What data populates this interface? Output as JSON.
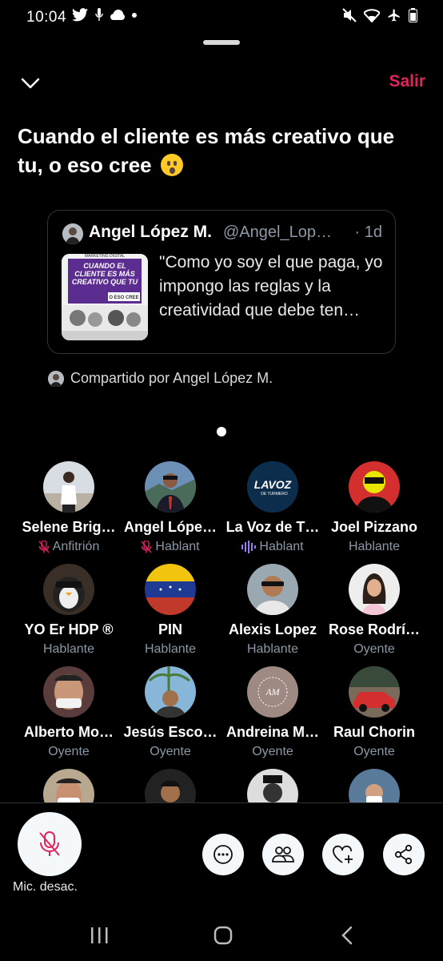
{
  "status_bar": {
    "time": "10:04",
    "left_icons": [
      "twitter-bird-icon",
      "microphone-icon",
      "cloud-icon",
      "dot-icon"
    ],
    "right_icons": [
      "mute-icon",
      "wifi-icon",
      "airplane-icon",
      "battery-icon"
    ]
  },
  "header": {
    "exit_label": "Salir"
  },
  "space": {
    "title": "Cuando el cliente es más creativo que tu, o eso cree"
  },
  "tweet": {
    "author": "Angel López M.",
    "handle": "@Angel_Lop…",
    "time": "· 1d",
    "text": "\"Como yo soy el que paga, yo impongo las reglas y la creatividad que debe ten…",
    "thumbnail_text": {
      "top": "MARKETING DIGITAL",
      "headline": "CUANDO EL CLIENTE ES MÁS CREATIVO QUE TU",
      "tag": "O ESO CREE"
    }
  },
  "shared_by": {
    "text": "Compartido por Angel López M."
  },
  "participants": [
    {
      "name": "Selene Brig…",
      "role": "Anfitrión",
      "role_icon": "mic-off-icon"
    },
    {
      "name": "Angel Lópe…",
      "role": "Hablant",
      "role_icon": "mic-off-icon"
    },
    {
      "name": "La Voz de T…",
      "role": "Hablant",
      "role_icon": "sound-wave-icon",
      "avatar_text": "LAVOZ",
      "avatar_subtext": "DE TURMERO"
    },
    {
      "name": "Joel Pizzano",
      "role": "Hablante",
      "role_icon": ""
    },
    {
      "name": "YO Er HDP ®",
      "role": "Hablante",
      "role_icon": ""
    },
    {
      "name": "PIN",
      "role": "Hablante",
      "role_icon": ""
    },
    {
      "name": "Alexis Lopez",
      "role": "Hablante",
      "role_icon": ""
    },
    {
      "name": "Rose Rodrí…",
      "role": "Oyente",
      "role_icon": ""
    },
    {
      "name": "Alberto Mo…",
      "role": "Oyente",
      "role_icon": ""
    },
    {
      "name": "Jesús Esco…",
      "role": "Oyente",
      "role_icon": ""
    },
    {
      "name": "Andreina M…",
      "role": "Oyente",
      "role_icon": ""
    },
    {
      "name": "Raul Chorin",
      "role": "Oyente",
      "role_icon": ""
    },
    {
      "name": "",
      "role": "",
      "role_icon": ""
    },
    {
      "name": "",
      "role": "",
      "role_icon": ""
    },
    {
      "name": "",
      "role": "",
      "role_icon": ""
    },
    {
      "name": "",
      "role": "",
      "role_icon": ""
    }
  ],
  "controls": {
    "mic_label": "Mic. desac.",
    "actions": [
      "more-icon",
      "people-icon",
      "heart-add-icon",
      "share-icon"
    ]
  },
  "colors": {
    "accent": "#e0245e",
    "background": "#000000",
    "secondary_text": "#8b98a5",
    "speaker_wave": "#9c7cf5"
  }
}
